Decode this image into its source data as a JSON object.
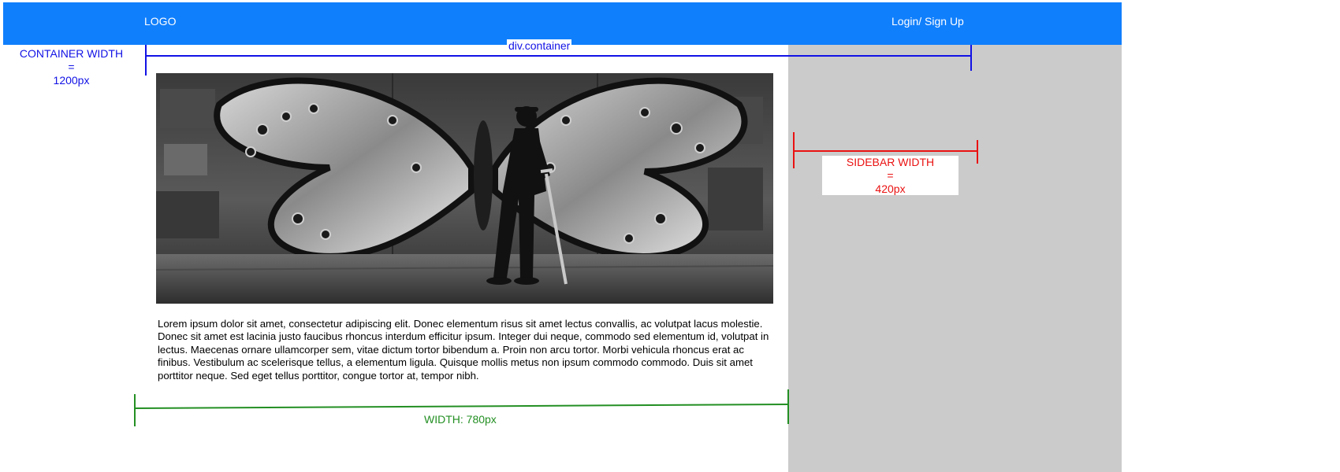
{
  "header": {
    "logo": "LOGO",
    "login": "Login/ Sign Up"
  },
  "annotations": {
    "container_tag": "div.container",
    "container_width": [
      "CONTAINER WIDTH",
      "=",
      "1200px"
    ],
    "sidebar_width": [
      "SIDEBAR WIDTH",
      "=",
      "420px"
    ],
    "main_width": "WIDTH: 780px"
  },
  "content": {
    "paragraph": "Lorem ipsum dolor sit amet, consectetur adipiscing elit. Donec elementum risus sit amet lectus convallis, ac volutpat lacus molestie. Donec sit amet est lacinia justo faucibus rhoncus interdum efficitur ipsum. Integer dui neque, commodo sed elementum id, volutpat in lectus. Maecenas ornare ullamcorper sem, vitae dictum tortor bibendum a. Proin non arcu tortor. Morbi vehicula rhoncus erat ac finibus. Vestibulum ac scelerisque tellus, a elementum ligula. Quisque mollis metus non ipsum commodo commodo. Duis sit amet porttitor neque. Sed eget tellus porttitor, congue tortor at, tempor nibh."
  },
  "colors": {
    "header_bg": "#107ffc",
    "sidebar_bg": "#cbcbcb",
    "annotation_blue": "#1212e6",
    "annotation_red": "#ea1111",
    "annotation_green": "#238f23"
  }
}
